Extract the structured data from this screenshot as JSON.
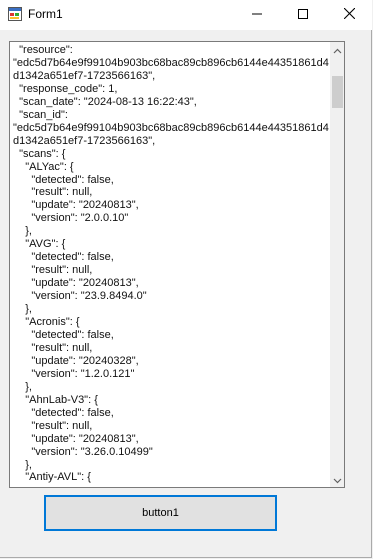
{
  "window": {
    "title": "Form1",
    "controls": {
      "minimize_icon": "minimize-icon",
      "maximize_icon": "maximize-icon",
      "close_icon": "close-icon"
    }
  },
  "textbox": {
    "lines": [
      "  \"resource\":",
      "\"edc5d7b64e9f99104b903bc68bac89cb896cb6144e44351861d4d1342a651ef7-1723566163\",",
      "  \"response_code\": 1,",
      "  \"scan_date\": \"2024-08-13 16:22:43\",",
      "  \"scan_id\":",
      "\"edc5d7b64e9f99104b903bc68bac89cb896cb6144e44351861d4d1342a651ef7-1723566163\",",
      "  \"scans\": {",
      "    \"ALYac\": {",
      "      \"detected\": false,",
      "      \"result\": null,",
      "      \"update\": \"20240813\",",
      "      \"version\": \"2.0.0.10\"",
      "    },",
      "    \"AVG\": {",
      "      \"detected\": false,",
      "      \"result\": null,",
      "      \"update\": \"20240813\",",
      "      \"version\": \"23.9.8494.0\"",
      "    },",
      "    \"Acronis\": {",
      "      \"detected\": false,",
      "      \"result\": null,",
      "      \"update\": \"20240328\",",
      "      \"version\": \"1.2.0.121\"",
      "    },",
      "    \"AhnLab-V3\": {",
      "      \"detected\": false,",
      "      \"result\": null,",
      "      \"update\": \"20240813\",",
      "      \"version\": \"3.26.0.10499\"",
      "    },",
      "    \"Antiy-AVL\": {"
    ]
  },
  "button1": {
    "label": "button1"
  },
  "colors": {
    "button_border": "#0078d7",
    "button_face": "#e1e1e1",
    "window_bg": "#f0f0f0"
  }
}
